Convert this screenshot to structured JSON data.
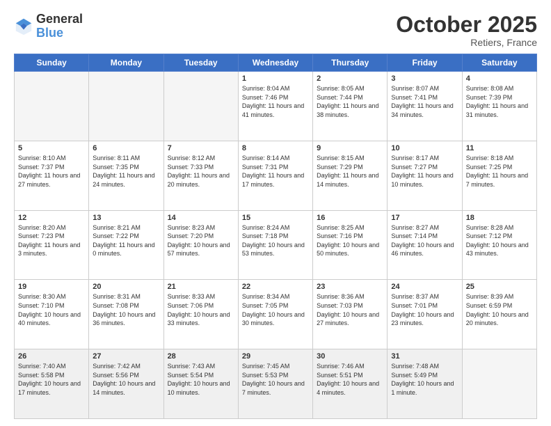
{
  "header": {
    "logo_general": "General",
    "logo_blue": "Blue",
    "month": "October 2025",
    "location": "Retiers, France"
  },
  "days_of_week": [
    "Sunday",
    "Monday",
    "Tuesday",
    "Wednesday",
    "Thursday",
    "Friday",
    "Saturday"
  ],
  "weeks": [
    [
      {
        "day": "",
        "info": "",
        "empty": true
      },
      {
        "day": "",
        "info": "",
        "empty": true
      },
      {
        "day": "",
        "info": "",
        "empty": true
      },
      {
        "day": "1",
        "info": "Sunrise: 8:04 AM\nSunset: 7:46 PM\nDaylight: 11 hours\nand 41 minutes."
      },
      {
        "day": "2",
        "info": "Sunrise: 8:05 AM\nSunset: 7:44 PM\nDaylight: 11 hours\nand 38 minutes."
      },
      {
        "day": "3",
        "info": "Sunrise: 8:07 AM\nSunset: 7:41 PM\nDaylight: 11 hours\nand 34 minutes."
      },
      {
        "day": "4",
        "info": "Sunrise: 8:08 AM\nSunset: 7:39 PM\nDaylight: 11 hours\nand 31 minutes."
      }
    ],
    [
      {
        "day": "5",
        "info": "Sunrise: 8:10 AM\nSunset: 7:37 PM\nDaylight: 11 hours\nand 27 minutes."
      },
      {
        "day": "6",
        "info": "Sunrise: 8:11 AM\nSunset: 7:35 PM\nDaylight: 11 hours\nand 24 minutes."
      },
      {
        "day": "7",
        "info": "Sunrise: 8:12 AM\nSunset: 7:33 PM\nDaylight: 11 hours\nand 20 minutes."
      },
      {
        "day": "8",
        "info": "Sunrise: 8:14 AM\nSunset: 7:31 PM\nDaylight: 11 hours\nand 17 minutes."
      },
      {
        "day": "9",
        "info": "Sunrise: 8:15 AM\nSunset: 7:29 PM\nDaylight: 11 hours\nand 14 minutes."
      },
      {
        "day": "10",
        "info": "Sunrise: 8:17 AM\nSunset: 7:27 PM\nDaylight: 11 hours\nand 10 minutes."
      },
      {
        "day": "11",
        "info": "Sunrise: 8:18 AM\nSunset: 7:25 PM\nDaylight: 11 hours\nand 7 minutes."
      }
    ],
    [
      {
        "day": "12",
        "info": "Sunrise: 8:20 AM\nSunset: 7:23 PM\nDaylight: 11 hours\nand 3 minutes."
      },
      {
        "day": "13",
        "info": "Sunrise: 8:21 AM\nSunset: 7:22 PM\nDaylight: 11 hours\nand 0 minutes."
      },
      {
        "day": "14",
        "info": "Sunrise: 8:23 AM\nSunset: 7:20 PM\nDaylight: 10 hours\nand 57 minutes."
      },
      {
        "day": "15",
        "info": "Sunrise: 8:24 AM\nSunset: 7:18 PM\nDaylight: 10 hours\nand 53 minutes."
      },
      {
        "day": "16",
        "info": "Sunrise: 8:25 AM\nSunset: 7:16 PM\nDaylight: 10 hours\nand 50 minutes."
      },
      {
        "day": "17",
        "info": "Sunrise: 8:27 AM\nSunset: 7:14 PM\nDaylight: 10 hours\nand 46 minutes."
      },
      {
        "day": "18",
        "info": "Sunrise: 8:28 AM\nSunset: 7:12 PM\nDaylight: 10 hours\nand 43 minutes."
      }
    ],
    [
      {
        "day": "19",
        "info": "Sunrise: 8:30 AM\nSunset: 7:10 PM\nDaylight: 10 hours\nand 40 minutes."
      },
      {
        "day": "20",
        "info": "Sunrise: 8:31 AM\nSunset: 7:08 PM\nDaylight: 10 hours\nand 36 minutes."
      },
      {
        "day": "21",
        "info": "Sunrise: 8:33 AM\nSunset: 7:06 PM\nDaylight: 10 hours\nand 33 minutes."
      },
      {
        "day": "22",
        "info": "Sunrise: 8:34 AM\nSunset: 7:05 PM\nDaylight: 10 hours\nand 30 minutes."
      },
      {
        "day": "23",
        "info": "Sunrise: 8:36 AM\nSunset: 7:03 PM\nDaylight: 10 hours\nand 27 minutes."
      },
      {
        "day": "24",
        "info": "Sunrise: 8:37 AM\nSunset: 7:01 PM\nDaylight: 10 hours\nand 23 minutes."
      },
      {
        "day": "25",
        "info": "Sunrise: 8:39 AM\nSunset: 6:59 PM\nDaylight: 10 hours\nand 20 minutes."
      }
    ],
    [
      {
        "day": "26",
        "info": "Sunrise: 7:40 AM\nSunset: 5:58 PM\nDaylight: 10 hours\nand 17 minutes.",
        "shaded": true
      },
      {
        "day": "27",
        "info": "Sunrise: 7:42 AM\nSunset: 5:56 PM\nDaylight: 10 hours\nand 14 minutes.",
        "shaded": true
      },
      {
        "day": "28",
        "info": "Sunrise: 7:43 AM\nSunset: 5:54 PM\nDaylight: 10 hours\nand 10 minutes.",
        "shaded": true
      },
      {
        "day": "29",
        "info": "Sunrise: 7:45 AM\nSunset: 5:53 PM\nDaylight: 10 hours\nand 7 minutes.",
        "shaded": true
      },
      {
        "day": "30",
        "info": "Sunrise: 7:46 AM\nSunset: 5:51 PM\nDaylight: 10 hours\nand 4 minutes.",
        "shaded": true
      },
      {
        "day": "31",
        "info": "Sunrise: 7:48 AM\nSunset: 5:49 PM\nDaylight: 10 hours\nand 1 minute.",
        "shaded": true
      },
      {
        "day": "",
        "info": "",
        "empty": true
      }
    ]
  ]
}
